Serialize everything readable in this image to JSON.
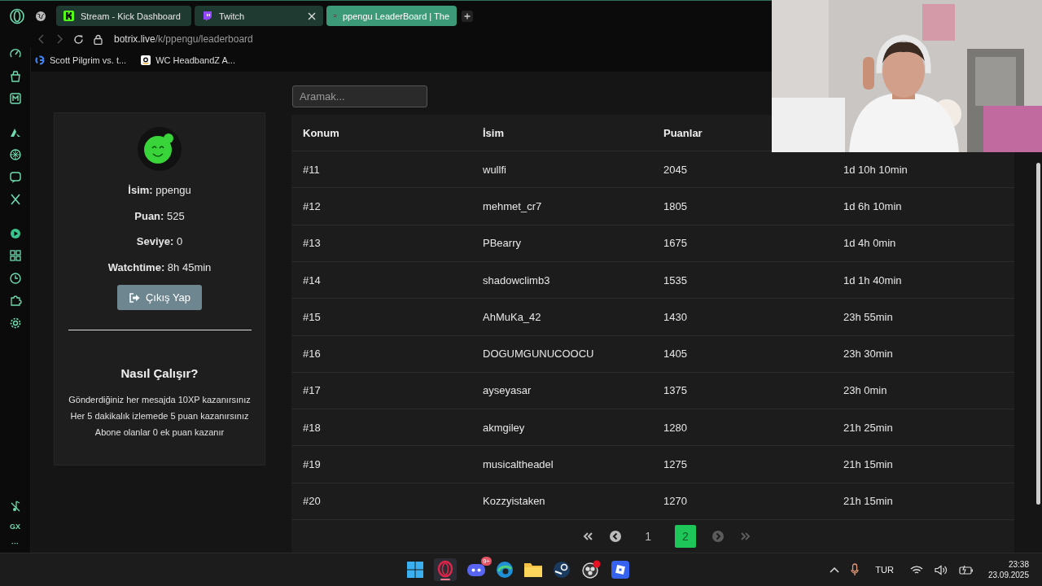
{
  "browser": {
    "tabs": [
      {
        "title": "Stream - Kick Dashboard",
        "kind": "kick",
        "selected": false,
        "closable": false
      },
      {
        "title": "Twitch",
        "kind": "twitch",
        "selected": false,
        "closable": true
      },
      {
        "title": "ppengu LeaderBoard | The",
        "kind": "botrix",
        "selected": true,
        "closable": false
      }
    ],
    "url": {
      "host": "botrix.live",
      "path": "/k/ppengu/leaderboard"
    },
    "bookmarks": [
      {
        "title": "Scott Pilgrim vs. t...",
        "kind": "google"
      },
      {
        "title": "WC HeadbandZ A...",
        "kind": "amazon"
      }
    ],
    "sidebar_labels": [
      "GX",
      "···"
    ]
  },
  "search": {
    "placeholder": "Aramak..."
  },
  "profile": {
    "fields": [
      {
        "label": "İsim:",
        "value": "ppengu"
      },
      {
        "label": "Puan:",
        "value": "525"
      },
      {
        "label": "Seviye:",
        "value": "0"
      },
      {
        "label": "Watchtime:",
        "value": "8h 45min"
      }
    ],
    "logout_button": "Çıkış Yap",
    "how_title": "Nasıl Çalışır?",
    "how_lines": [
      "Gönderdiğiniz her mesajda 10XP kazanırsınız",
      "Her 5 dakikalık izlemede 5 puan kazanırsınız",
      "Abone olanlar 0 ek puan kazanır"
    ]
  },
  "table": {
    "columns": [
      "Konum",
      "İsim",
      "Puanlar"
    ],
    "rows": [
      [
        "#11",
        "wullfi",
        "2045",
        "1d 10h 10min"
      ],
      [
        "#12",
        "mehmet_cr7",
        "1805",
        "1d 6h 10min"
      ],
      [
        "#13",
        "PBearry",
        "1675",
        "1d 4h 0min"
      ],
      [
        "#14",
        "shadowclimb3",
        "1535",
        "1d 1h 40min"
      ],
      [
        "#15",
        "AhMuKa_42",
        "1430",
        "23h 55min"
      ],
      [
        "#16",
        "DOGUMGUNUCOOCU",
        "1405",
        "23h 30min"
      ],
      [
        "#17",
        "ayseyasar",
        "1375",
        "23h 0min"
      ],
      [
        "#18",
        "akmgiley",
        "1280",
        "21h 25min"
      ],
      [
        "#19",
        "musicaltheadel",
        "1275",
        "21h 15min"
      ],
      [
        "#20",
        "Kozzyistaken",
        "1270",
        "21h 15min"
      ]
    ]
  },
  "pagination": {
    "pages": [
      {
        "label": "1",
        "selected": false
      },
      {
        "label": "2",
        "selected": true
      }
    ],
    "prev_disabled": false,
    "next_disabled": true
  },
  "taskbar": {
    "badge": "9+",
    "language": "TUR",
    "time": "23:38",
    "date": "23.09.2025"
  }
}
